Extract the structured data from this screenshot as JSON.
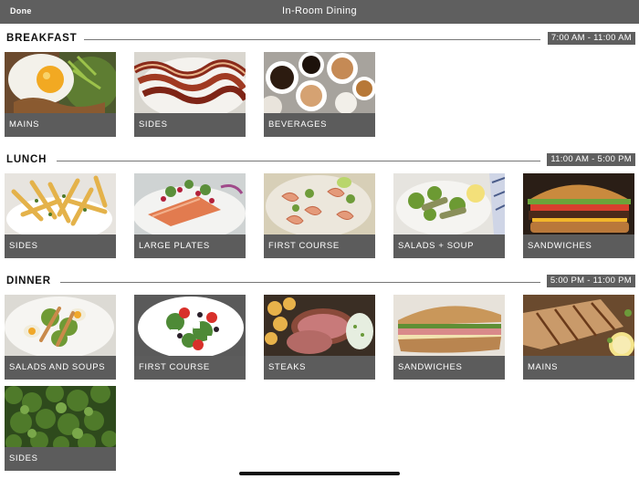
{
  "header": {
    "done_label": "Done",
    "title": "In-Room Dining"
  },
  "sections": [
    {
      "name": "BREAKFAST",
      "hours": "7:00 AM - 11:00 AM",
      "items": [
        {
          "label": "MAINS",
          "image": "eggs-photo"
        },
        {
          "label": "SIDES",
          "image": "bacon-photo"
        },
        {
          "label": "BEVERAGES",
          "image": "coffee-photo"
        }
      ]
    },
    {
      "name": "LUNCH",
      "hours": "11:00 AM - 5:00 PM",
      "items": [
        {
          "label": "SIDES",
          "image": "fries-photo"
        },
        {
          "label": "LARGE PLATES",
          "image": "salmon-photo"
        },
        {
          "label": "FIRST COURSE",
          "image": "shrimp-photo"
        },
        {
          "label": "SALADS + SOUP",
          "image": "salad-photo"
        },
        {
          "label": "SANDWICHES",
          "image": "burger-photo"
        }
      ]
    },
    {
      "name": "DINNER",
      "hours": "5:00 PM - 11:00 PM",
      "items": [
        {
          "label": "SALADS AND SOUPS",
          "image": "egg-salad-photo"
        },
        {
          "label": "FIRST COURSE",
          "image": "greek-salad-photo"
        },
        {
          "label": "STEAKS",
          "image": "steak-photo"
        },
        {
          "label": "SANDWICHES",
          "image": "sandwich-photo"
        },
        {
          "label": "MAINS",
          "image": "grilled-fish-photo"
        },
        {
          "label": "SIDES",
          "image": "kale-photo"
        }
      ]
    }
  ],
  "colors": {
    "bar": "#5f5f5f",
    "label_bg": "#5c5c5c"
  }
}
